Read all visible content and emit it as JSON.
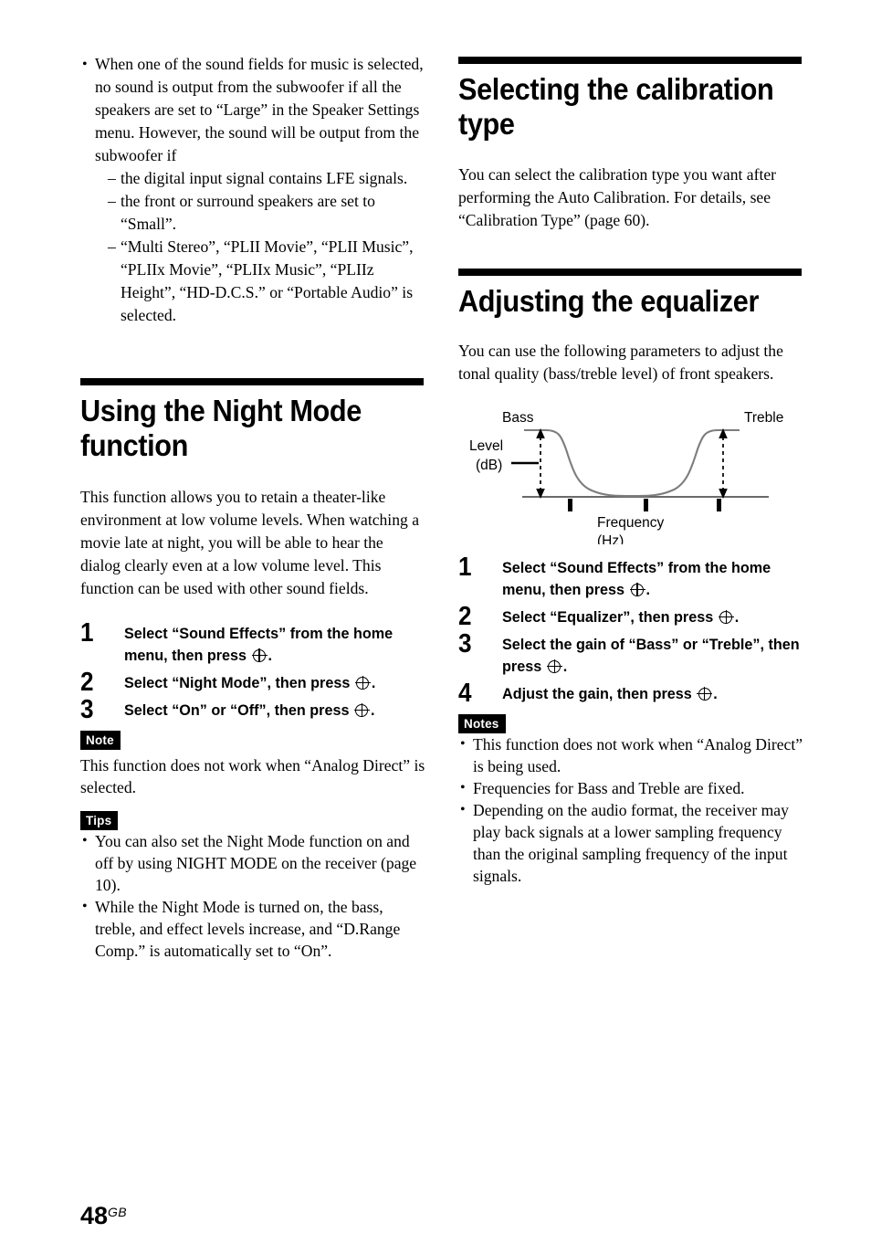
{
  "page": {
    "number": "48",
    "region_suffix": "GB"
  },
  "left_column": {
    "intro_bullets": [
      {
        "text": "When one of the sound fields for music is selected, no sound is output from the subwoofer if all the speakers are set to “Large” in the Speaker Settings menu. However, the sound will be output from the subwoofer if",
        "sub_items": [
          "the digital input signal contains LFE signals.",
          "the front or surround speakers are set to “Small”.",
          "“Multi Stereo”, “PLII Movie”, “PLII Music”, “PLIIx Movie”, “PLIIx Music”, “PLIIz Height”, “HD-D.C.S.” or “Portable Audio” is selected."
        ]
      }
    ],
    "section": {
      "heading": "Using the Night Mode function",
      "intro": "This function allows you to retain a theater-like environment at low volume levels. When watching a movie late at night, you will be able to hear the dialog clearly even at a low volume level. This function can be used with other sound fields.",
      "steps": [
        {
          "number": "1",
          "text_before": "Select “Sound Effects” from the home menu, then press",
          "text_after": "."
        },
        {
          "number": "2",
          "text_before": "Select “Night Mode”, then press",
          "text_after": "."
        },
        {
          "number": "3",
          "text_before": "Select “On” or “Off”,  then press",
          "text_after": "."
        }
      ],
      "note": {
        "badge": "Note",
        "text": "This function does not work when “Analog Direct” is selected."
      },
      "tips": {
        "badge": "Tips",
        "items": [
          "You can also set the Night Mode function on and off by using NIGHT MODE on the receiver (page 10).",
          "While the Night Mode is turned on, the bass, treble, and effect levels increase, and “D.Range Comp.” is automatically set to “On”."
        ]
      }
    }
  },
  "right_column": {
    "calibration_section": {
      "heading": "Selecting the calibration type",
      "body": "You can select the calibration type you want after performing the Auto Calibration. For details, see “Calibration Type” (page 60)."
    },
    "equalizer_section": {
      "heading": "Adjusting the equalizer",
      "body": "You can use the following parameters to adjust the tonal quality (bass/treble level) of front speakers.",
      "steps": [
        {
          "number": "1",
          "text_before": "Select “Sound Effects” from the home menu, then press",
          "text_after": "."
        },
        {
          "number": "2",
          "text_before": "Select “Equalizer”, then press",
          "text_after": "."
        },
        {
          "number": "3",
          "text_before": "Select the gain of “Bass” or “Treble”, then press",
          "text_after": "."
        },
        {
          "number": "4",
          "text_before": "Adjust the gain, then press",
          "text_after": "."
        }
      ],
      "notes": {
        "badge": "Notes",
        "items": [
          "This function does not work when “Analog Direct” is being used.",
          "Frequencies for Bass and Treble are fixed.",
          "Depending on the audio format, the receiver may play back signals at a lower sampling frequency than the original sampling frequency of the input signals."
        ]
      }
    }
  },
  "chart_data": {
    "type": "line",
    "title": "",
    "xlabel": "Frequency",
    "xlabel_unit": "(Hz)",
    "ylabel": "Level",
    "ylabel_unit": "(dB)",
    "labels": {
      "bass": "Bass",
      "treble": "Treble"
    },
    "description": "Equalizer response curve: boosted at low (Bass) and high (Treble) frequencies, flat at mid frequencies. Vertical double-headed dashed arrows mark the Bass and Treble level (dB) from the baseline.",
    "grid": false,
    "legend": false,
    "axis_ticks": 3,
    "x": [
      0,
      6,
      12,
      18,
      24,
      30,
      36,
      42,
      50,
      58,
      64,
      70,
      76,
      82,
      88,
      94,
      100
    ],
    "y": [
      100,
      100,
      99,
      95,
      82,
      58,
      32,
      16,
      6,
      6,
      16,
      32,
      58,
      82,
      95,
      99,
      100
    ],
    "ylim": [
      0,
      100
    ],
    "xlim": [
      0,
      100
    ],
    "annotations": [
      {
        "name": "bass-level-arrow",
        "x": 7,
        "y_from": 0,
        "y_to": 100
      },
      {
        "name": "treble-level-arrow",
        "x": 93,
        "y_from": 0,
        "y_to": 100
      }
    ]
  }
}
